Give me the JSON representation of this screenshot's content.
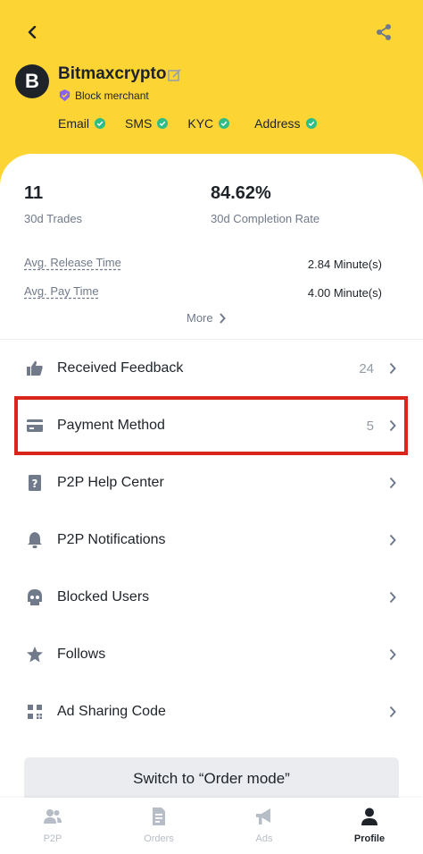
{
  "profile": {
    "avatar_letter": "B",
    "name": "Bitmaxcrypto",
    "merchant_label": "Block merchant",
    "verifications": [
      "Email",
      "SMS",
      "KYC",
      "Address"
    ]
  },
  "stats": {
    "trades_value": "11",
    "trades_label": "30d Trades",
    "completion_value": "84.62%",
    "completion_label": "30d Completion Rate"
  },
  "metrics": {
    "release_label": "Avg. Release Time",
    "release_value": "2.84 Minute(s)",
    "pay_label": "Avg. Pay Time",
    "pay_value": "4.00 Minute(s)",
    "more_label": "More"
  },
  "menu": [
    {
      "label": "Received Feedback",
      "count": "24",
      "icon": "thumbs-up-icon"
    },
    {
      "label": "Payment Method",
      "count": "5",
      "icon": "card-icon"
    },
    {
      "label": "P2P Help Center",
      "count": "",
      "icon": "help-book-icon"
    },
    {
      "label": "P2P Notifications",
      "count": "",
      "icon": "bell-icon"
    },
    {
      "label": "Blocked Users",
      "count": "",
      "icon": "blocked-user-icon"
    },
    {
      "label": "Follows",
      "count": "",
      "icon": "star-icon"
    },
    {
      "label": "Ad Sharing Code",
      "count": "",
      "icon": "qr-code-icon"
    }
  ],
  "switch_label": "Switch to “Order mode”",
  "tabs": [
    {
      "label": "P2P",
      "icon": "users-icon"
    },
    {
      "label": "Orders",
      "icon": "document-icon"
    },
    {
      "label": "Ads",
      "icon": "megaphone-icon"
    },
    {
      "label": "Profile",
      "icon": "person-icon"
    }
  ],
  "colors": {
    "brand_yellow": "#fcd535",
    "check_green": "#2ebd85",
    "highlight_red": "#d9251c",
    "merchant_purple": "#8a63f0"
  }
}
